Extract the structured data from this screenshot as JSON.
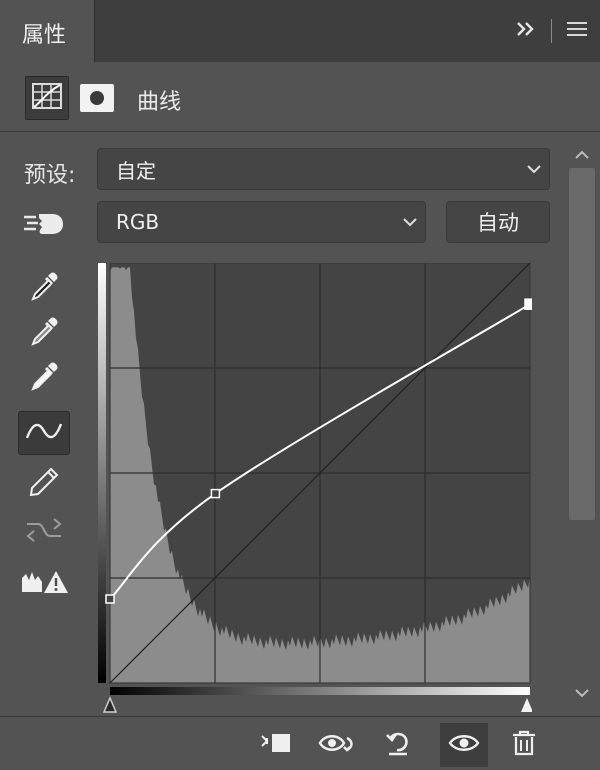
{
  "panel": {
    "tab_label": "属性",
    "title": "曲线"
  },
  "preset": {
    "label": "预设:",
    "value": "自定"
  },
  "channel": {
    "value": "RGB"
  },
  "auto_label": "自动",
  "tools": [
    {
      "icon": "eyedropper-black-icon"
    },
    {
      "icon": "eyedropper-gray-icon"
    },
    {
      "icon": "eyedropper-white-icon"
    },
    {
      "icon": "curve-point-tool-icon",
      "active": true
    },
    {
      "icon": "pencil-icon"
    },
    {
      "icon": "smooth-curve-icon"
    },
    {
      "icon": "clipping-warning-icon"
    }
  ],
  "curve": {
    "points": [
      [
        0,
        51
      ],
      [
        64,
        115
      ],
      [
        255,
        230
      ]
    ]
  },
  "bottom_tools": [
    "clip-to-layer-icon",
    "view-previous-state-icon",
    "reset-icon",
    "visibility-eye-icon",
    "trash-icon"
  ],
  "colors": {
    "panel_bg": "#535353",
    "tab_bar": "#3e3e3e",
    "graph_bg": "#444444",
    "histogram": "#8c8c8c",
    "curve": "#ffffff"
  }
}
